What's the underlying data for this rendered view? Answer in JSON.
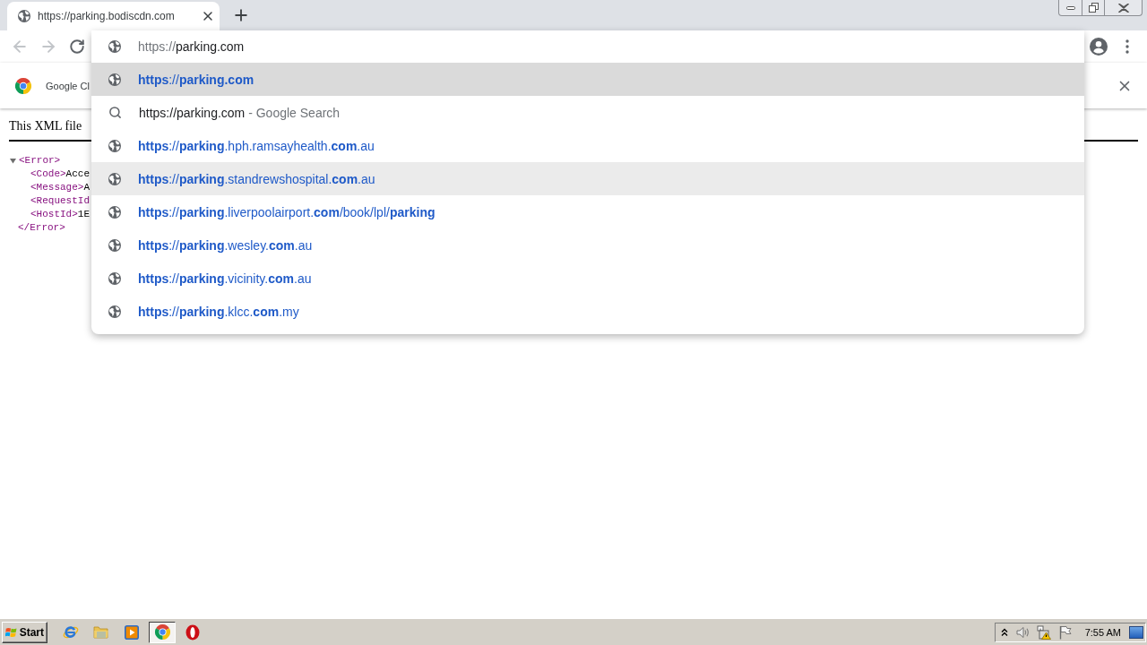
{
  "tabs": [
    {
      "title": "https://parking.bodiscdn.com",
      "selected": true
    }
  ],
  "toolbar": {
    "back": {
      "disabled": true
    },
    "forward": {
      "disabled": true
    },
    "reload": {
      "disabled": false
    }
  },
  "omnibox": {
    "scheme": "https://",
    "host": "parking.com",
    "suggestions": [
      {
        "kind": "url",
        "text": "**https**://**parking.com**",
        "selected": true,
        "hovered": false
      },
      {
        "kind": "search",
        "text": "https://parking.com",
        "description": "- Google Search",
        "selected": false,
        "hovered": false
      },
      {
        "kind": "url",
        "text": "**https**://**parking**.hph.ramsayhealth.**com**.au",
        "selected": false,
        "hovered": false
      },
      {
        "kind": "url",
        "text": "**https**://**parking**.standrewshospital.**com**.au",
        "selected": false,
        "hovered": true
      },
      {
        "kind": "url",
        "text": "**https**://**parking**.liverpoolairport.**com**/book/lpl/**parking**",
        "selected": false,
        "hovered": false
      },
      {
        "kind": "url",
        "text": "**https**://**parking**.wesley.**com**.au",
        "selected": false,
        "hovered": false
      },
      {
        "kind": "url",
        "text": "**https**://**parking**.vicinity.**com**.au",
        "selected": false,
        "hovered": false
      },
      {
        "kind": "url",
        "text": "**https**://**parking**.klcc.**com**.my",
        "selected": false,
        "hovered": false
      }
    ]
  },
  "infobar": {
    "text": "Google Cl"
  },
  "document": {
    "notice": "This XML file",
    "tree": {
      "open_tag": "<Error>",
      "expanded": true,
      "children": [
        {
          "tag": "<Code>",
          "text": "Acce"
        },
        {
          "tag": "<Message>",
          "text": "A"
        },
        {
          "tag": "<RequestId"
        },
        {
          "tag": "<HostId>",
          "text": "1E"
        }
      ],
      "close_tag": "</Error>"
    }
  },
  "taskbar": {
    "start": "Start",
    "apps": [
      {
        "kind": "ie",
        "selected": false
      },
      {
        "kind": "explorer",
        "selected": false
      },
      {
        "kind": "media",
        "selected": false
      },
      {
        "kind": "chrome",
        "selected": true
      },
      {
        "kind": "opera",
        "selected": false
      }
    ],
    "clock": "7:55 AM"
  }
}
